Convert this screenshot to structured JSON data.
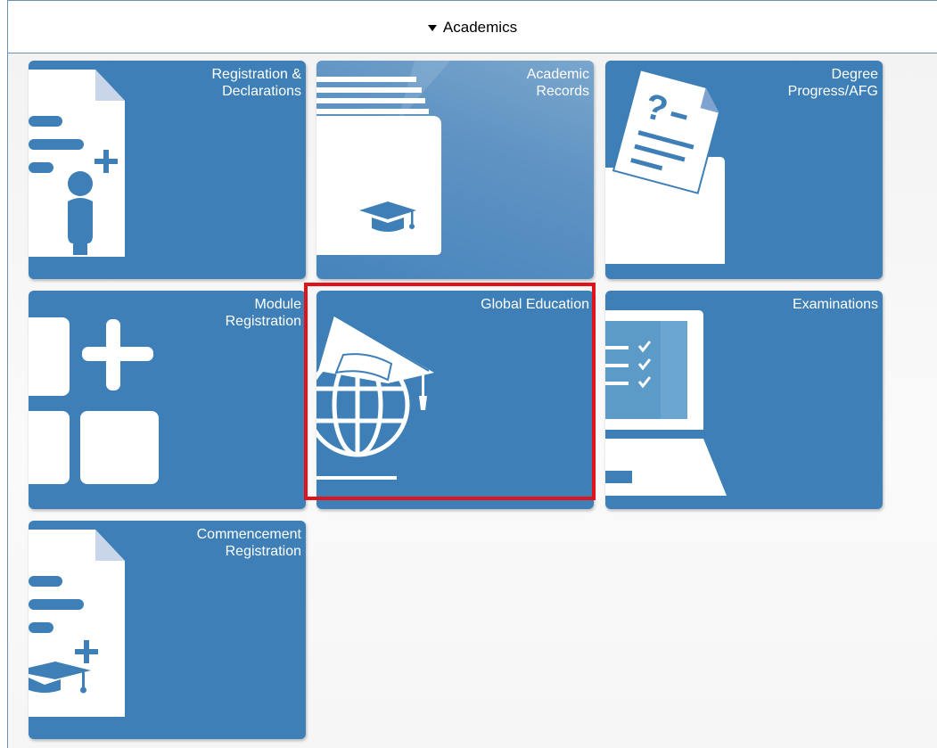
{
  "section": {
    "title": "Academics",
    "expanded_icon": "caret-down-icon"
  },
  "tiles": [
    {
      "label": "Registration &\nDeclarations",
      "icon": "document-add-person-icon"
    },
    {
      "label": "Academic\nRecords",
      "icon": "folder-graduation-cap-icon"
    },
    {
      "label": "Degree\nProgress/AFG",
      "icon": "question-document-folder-icon"
    },
    {
      "label": "Module\nRegistration",
      "icon": "add-module-grid-icon"
    },
    {
      "label": "Global Education",
      "icon": "globe-graduation-cap-icon"
    },
    {
      "label": "Examinations",
      "icon": "monitor-checklist-icon"
    },
    {
      "label": "Commencement\nRegistration",
      "icon": "document-add-graduation-cap-icon"
    }
  ],
  "colors": {
    "tile": "#3d7fb6",
    "highlight": "#e0131b",
    "header_border": "#6f8fb0"
  },
  "selected_tile": "Global Education"
}
